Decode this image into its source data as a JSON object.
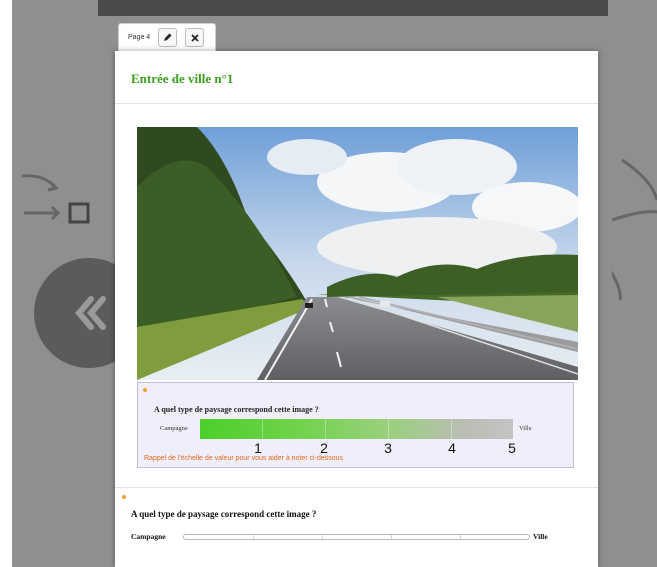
{
  "tab": {
    "label": "Page 4",
    "edit_icon": "pencil-icon",
    "close_icon": "close-icon"
  },
  "panel": {
    "title": "Entrée de ville n°1"
  },
  "photo": {
    "alt": "road-landscape-photo"
  },
  "legend": {
    "question": "A quel type de paysage correspond cette image ?",
    "left_label": "Campagne",
    "right_label": "Ville",
    "numbers": [
      "1",
      "2",
      "3",
      "4",
      "5"
    ],
    "reminder": "Rappel de l'échelle de valeur pour vous aider à noter ci-dessous",
    "colors": {
      "start": "#4ccf2a",
      "end": "#c4c4c4"
    }
  },
  "survey": {
    "question": "A quel type de paysage correspond cette image ?",
    "left_label": "Campagne",
    "right_label": "Ville"
  },
  "colors": {
    "title": "#3b9e1e",
    "reminder": "#e26a1c",
    "backdrop": "#8f8f8f"
  }
}
